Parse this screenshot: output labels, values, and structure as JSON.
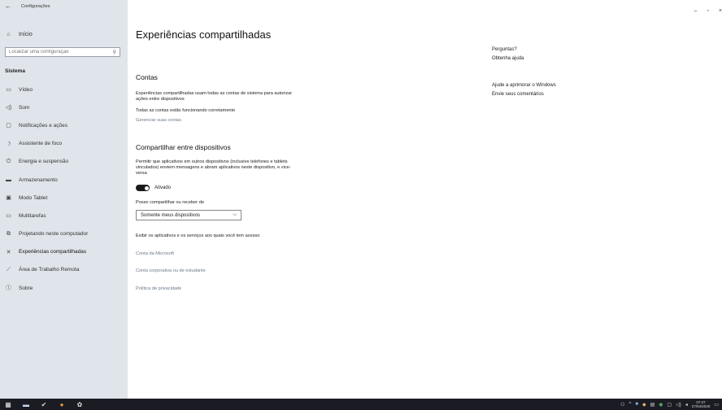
{
  "window": {
    "title": "Configurações",
    "controls": [
      "–",
      "▫",
      "×"
    ]
  },
  "sidebar": {
    "home_label": "Início",
    "search_placeholder": "Localizar uma configuração",
    "section_heading": "Sistema",
    "items": [
      {
        "label": "Vídeo",
        "icon": "monitor-icon"
      },
      {
        "label": "Som",
        "icon": "speaker-icon"
      },
      {
        "label": "Notificações e ações",
        "icon": "message-icon"
      },
      {
        "label": "Assistente de foco",
        "icon": "moon-icon"
      },
      {
        "label": "Energia e suspensão",
        "icon": "power-icon"
      },
      {
        "label": "Armazenamento",
        "icon": "storage-icon"
      },
      {
        "label": "Modo Tablet",
        "icon": "tablet-icon"
      },
      {
        "label": "Multitarefas",
        "icon": "multitask-icon"
      },
      {
        "label": "Projetando neste computador",
        "icon": "project-icon"
      },
      {
        "label": "Experiências compartilhadas",
        "icon": "shared-icon"
      },
      {
        "label": "Área de Trabalho Remota",
        "icon": "remote-icon"
      },
      {
        "label": "Sobre",
        "icon": "info-icon"
      }
    ]
  },
  "main": {
    "page_title": "Experiências compartilhadas",
    "accounts": {
      "heading": "Contas",
      "description": "Experiências compartilhadas usam todas as contas de sistema para autorizar ações entre dispositivos",
      "status": "Todas as contas estão funcionando corretamente",
      "manage_link": "Gerenciar suas contas"
    },
    "share": {
      "heading": "Compartilhar entre dispositivos",
      "description": "Permitir que aplicativos em outros dispositivos (inclusive telefones e tablets vinculados) enviem mensagens e abram aplicativos neste dispositivo, e vice-versa",
      "toggle_label": "Ativado",
      "dropdown_label": "Posso compartilhar ou receber de",
      "dropdown_value": "Somente meus dispositivos"
    },
    "links": {
      "apps_services": "Exibir os aplicativos e os serviços aos quais você tem acesso",
      "microsoft_account": "Conta da Microsoft",
      "work_account": "Conta corporativa ou de estudante",
      "privacy": "Política de privacidade"
    }
  },
  "right_panel": {
    "questions_heading": "Perguntas?",
    "get_help": "Obtenha ajuda",
    "improve_heading": "Ajude a aprimorar o Windows",
    "feedback": "Envie seus comentários"
  },
  "taskbar": {
    "time": "07:47",
    "date": "27/04/2020"
  }
}
